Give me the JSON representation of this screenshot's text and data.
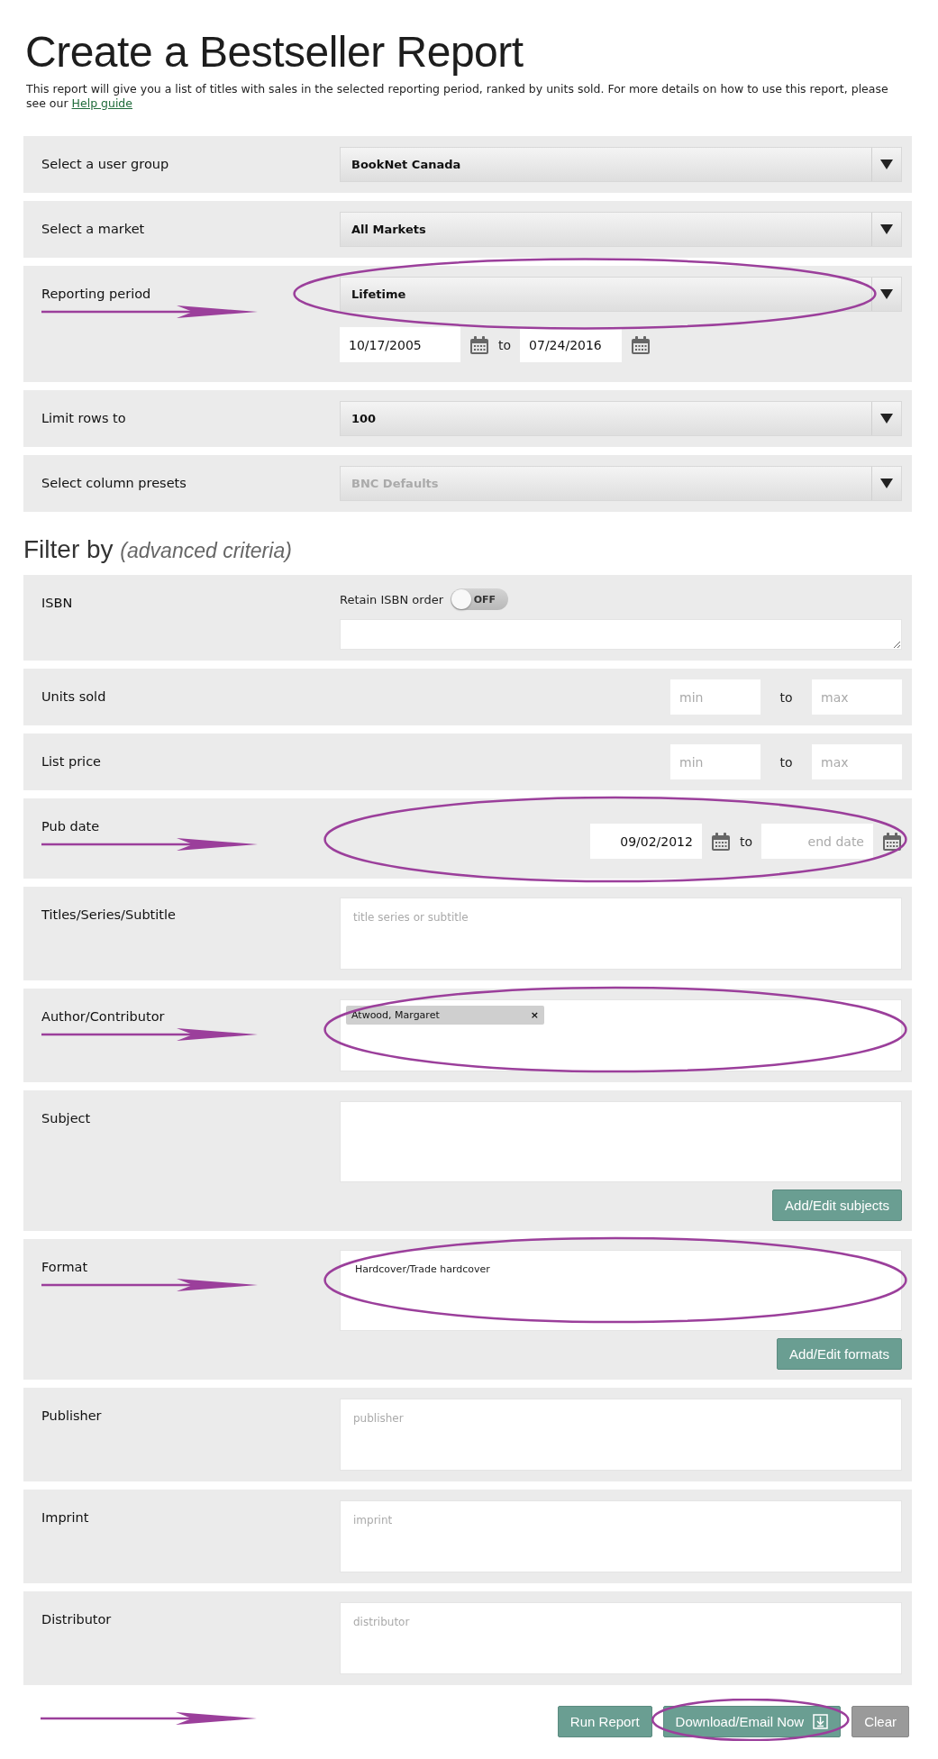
{
  "title": "Create a Bestseller Report",
  "description": {
    "text": "This report will give you a list of titles with sales in the selected reporting period, ranked by units sold. For more details on how to use this report, please see our",
    "link": "Help guide"
  },
  "settings": [
    {
      "label": "Select a user group",
      "kind": "select",
      "value": "BookNet Canada",
      "disabled": false,
      "annotated": false
    },
    {
      "label": "Select a market",
      "kind": "select",
      "value": "All Markets",
      "disabled": false,
      "annotated": false
    },
    {
      "label": "Reporting period",
      "kind": "select_dates",
      "value": "Lifetime",
      "disabled": false,
      "annotated": true,
      "from": "10/17/2005",
      "to_label": "to",
      "to": "07/24/2016"
    },
    {
      "label": "Limit rows to",
      "kind": "select",
      "value": "100",
      "disabled": false,
      "annotated": false
    },
    {
      "label": "Select column presets",
      "kind": "select",
      "value": "BNC Defaults",
      "disabled": true,
      "annotated": false
    }
  ],
  "filter_heading": {
    "text": "Filter by",
    "note": "(advanced criteria)"
  },
  "filters": [
    {
      "label": "ISBN",
      "kind": "isbn",
      "annotated": false,
      "toggle": {
        "label": "Retain ISBN order",
        "state": "OFF",
        "on": false
      }
    },
    {
      "label": "Units sold",
      "kind": "range",
      "annotated": false,
      "min": {
        "placeholder": "min"
      },
      "to_label": "to",
      "max": {
        "placeholder": "max"
      }
    },
    {
      "label": "List price",
      "kind": "range",
      "annotated": false,
      "min": {
        "placeholder": "min"
      },
      "to_label": "to",
      "max": {
        "placeholder": "max"
      }
    },
    {
      "label": "Pub date",
      "kind": "date_range",
      "annotated": true,
      "from": "09/02/2012",
      "to_label": "to",
      "end": {
        "placeholder": "end date"
      }
    },
    {
      "label": "Titles/Series/Subtitle",
      "kind": "text",
      "annotated": false,
      "placeholder": "title series or subtitle"
    },
    {
      "label": "Author/Contributor",
      "kind": "text",
      "annotated": true,
      "chips": [
        {
          "label": "Atwood, Margaret",
          "remove": "×"
        }
      ]
    },
    {
      "label": "Subject",
      "kind": "text",
      "annotated": false,
      "button": "Add/Edit subjects"
    },
    {
      "label": "Format",
      "kind": "text",
      "annotated": true,
      "value": "Hardcover/Trade hardcover",
      "button": "Add/Edit formats"
    },
    {
      "label": "Publisher",
      "kind": "text",
      "annotated": false,
      "placeholder": "publisher"
    },
    {
      "label": "Imprint",
      "kind": "text",
      "annotated": false,
      "placeholder": "imprint"
    },
    {
      "label": "Distributor",
      "kind": "text",
      "annotated": false,
      "placeholder": "distributor"
    }
  ],
  "actions": {
    "annotated": true,
    "buttons": [
      {
        "label": "Run Report",
        "kind": "primary",
        "circled": false,
        "icon": false
      },
      {
        "label": "Download/Email Now",
        "kind": "primary",
        "circled": true,
        "icon": true
      },
      {
        "label": "Clear",
        "kind": "secondary",
        "circled": false,
        "icon": false
      }
    ]
  }
}
